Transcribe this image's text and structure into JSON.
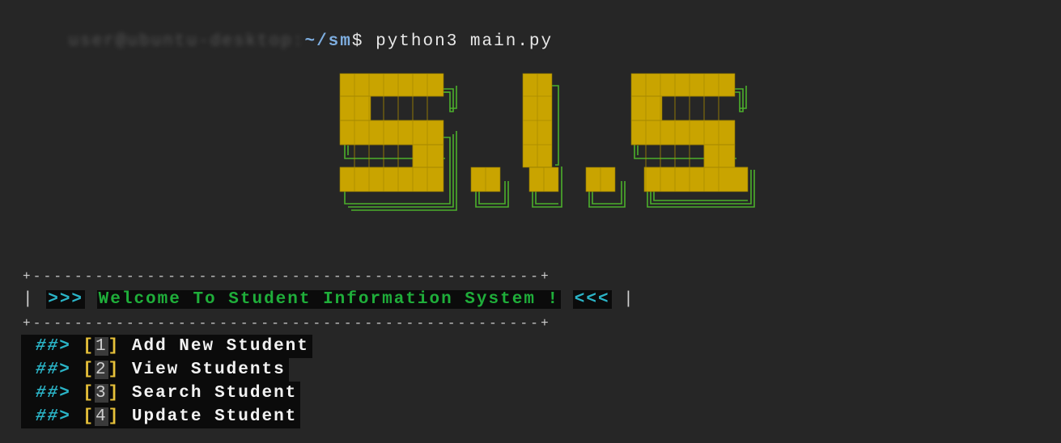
{
  "terminal": {
    "prompt_host": "user@ubuntu-desktop:",
    "prompt_path": "~/sm",
    "prompt_symbol": "$",
    "command": " python3 main.py"
  },
  "logo": {
    "text": "S.I.S",
    "fill_color": "#c9a400",
    "shadow_color": "#4caf2c"
  },
  "banner": {
    "border_top": "+-------------------------------------------------+",
    "border_bottom": "+-------------------------------------------------+",
    "pipe_left": "|",
    "pipe_right": "|",
    "arrow_left": ">>>",
    "arrow_right": "<<<",
    "welcome": "Welcome To Student Information System !"
  },
  "menu": {
    "prefix": "##>",
    "items": [
      {
        "number": "1",
        "label": "Add New Student"
      },
      {
        "number": "2",
        "label": "View Students"
      },
      {
        "number": "3",
        "label": "Search Student"
      },
      {
        "number": "4",
        "label": "Update Student"
      }
    ]
  },
  "colors": {
    "background": "#262626",
    "cyan": "#2bb5c8",
    "green": "#1fae3a",
    "yellow": "#e8c23a"
  }
}
